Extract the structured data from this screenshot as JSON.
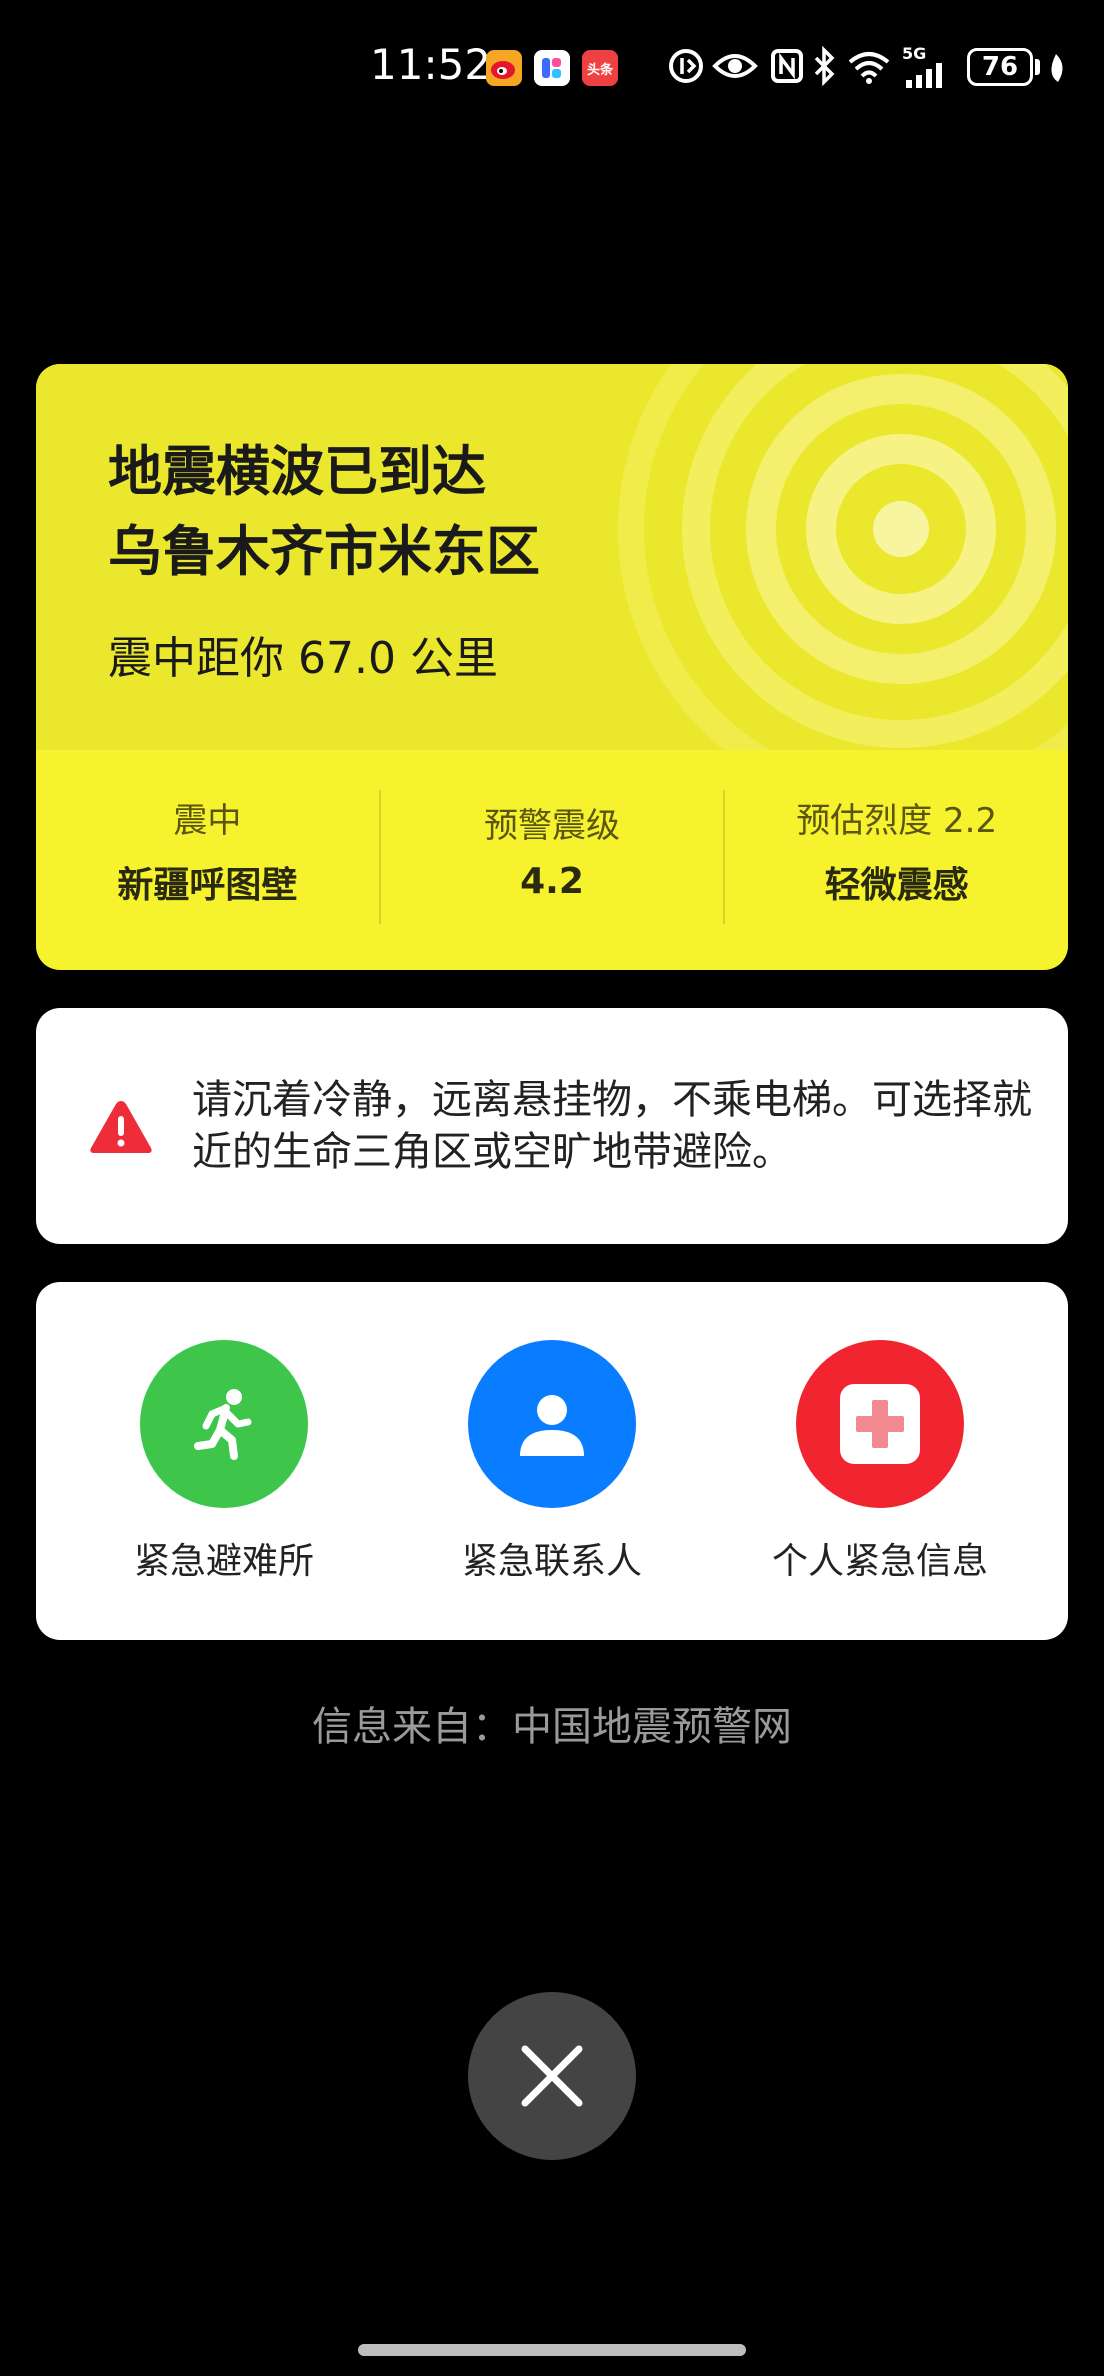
{
  "status_bar": {
    "time": "11:52",
    "app_icons": [
      "weibo-icon",
      "app-icon",
      "toutiao-icon"
    ],
    "toutiao_label": "头条",
    "battery": "76",
    "signal_label": "5G"
  },
  "alert": {
    "title_line1": "地震横波已到达",
    "title_line2": "乌鲁木齐市米东区",
    "distance": "震中距你 67.0 公里",
    "stats": [
      {
        "label": "震中",
        "value": "新疆呼图壁"
      },
      {
        "label": "预警震级",
        "value": "4.2"
      },
      {
        "label": "预估烈度 2.2",
        "value": "轻微震感"
      }
    ],
    "colors": {
      "card": "#f6f22d",
      "card_top": "#ebe72d"
    }
  },
  "advice": {
    "text": "请沉着冷静，远离悬挂物，不乘电梯。可选择就近的生命三角区或空旷地带避险。",
    "icon": "warning-icon"
  },
  "actions": [
    {
      "label": "紧急避难所",
      "icon": "running-person-icon",
      "color": "#3ec64a"
    },
    {
      "label": "紧急联系人",
      "icon": "person-icon",
      "color": "#0a7cff"
    },
    {
      "label": "个人紧急信息",
      "icon": "medical-cross-icon",
      "color": "#f0252f"
    }
  ],
  "source": "信息来自：中国地震预警网",
  "close_icon": "close-icon"
}
